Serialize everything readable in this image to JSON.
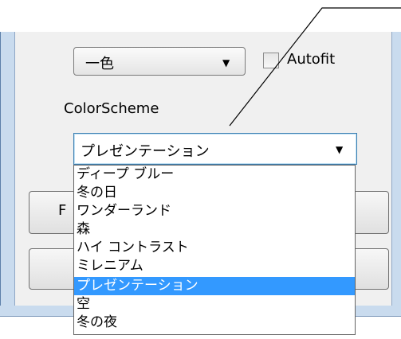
{
  "mode_combo": {
    "value": "一色"
  },
  "autofit": {
    "label": "Autofit",
    "checked": false
  },
  "color_scheme": {
    "label": "ColorScheme",
    "value": "プレゼンテーション",
    "options": [
      {
        "label": "ディープ ブルー",
        "selected": false
      },
      {
        "label": "冬の日",
        "selected": false
      },
      {
        "label": "ワンダーランド",
        "selected": false
      },
      {
        "label": "森",
        "selected": false
      },
      {
        "label": "ハイ コントラスト",
        "selected": false
      },
      {
        "label": "ミレニアム",
        "selected": false
      },
      {
        "label": "プレゼンテーション",
        "selected": true
      },
      {
        "label": "空",
        "selected": false
      },
      {
        "label": "冬の夜",
        "selected": false
      }
    ]
  },
  "background_buttons": {
    "first_label_fragment": "F"
  },
  "icons": {
    "dropdown_arrow": "▼"
  }
}
